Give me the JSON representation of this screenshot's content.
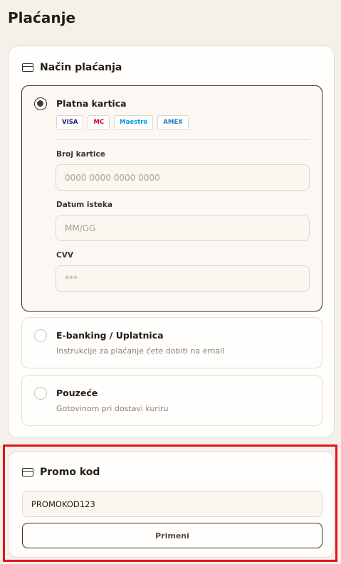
{
  "page": {
    "title": "Plaćanje"
  },
  "payment": {
    "heading": "Način plaćanja",
    "icon": "credit-card-icon",
    "card_option": {
      "title": "Platna kartica",
      "selected": true,
      "badges": [
        {
          "label": "VISA",
          "color": "#1a1f71"
        },
        {
          "label": "MC",
          "color": "#d6002a"
        },
        {
          "label": "Maestro",
          "color": "#0099df"
        },
        {
          "label": "AMEX",
          "color": "#2e77bb"
        }
      ],
      "fields": [
        {
          "label": "Broj kartice",
          "placeholder": "0000 0000 0000 0000",
          "value": ""
        },
        {
          "label": "Datum isteka",
          "placeholder": "MM/GG",
          "value": ""
        },
        {
          "label": "CVV",
          "placeholder": "***",
          "value": ""
        }
      ]
    },
    "ebanking_option": {
      "title": "E-banking / Uplatnica",
      "description": "Instrukcije za plaćanje ćete dobiti na email",
      "selected": false
    },
    "cod_option": {
      "title": "Pouzeće",
      "description": "Gotovinom pri dostavi kuriru",
      "selected": false
    }
  },
  "promo": {
    "heading": "Promo kod",
    "icon": "credit-card-icon",
    "value": "PROMOKOD123",
    "apply_label": "Primeni"
  },
  "colors": {
    "accent": "#3a2e24",
    "background": "#f4f0ea",
    "highlight": "#e0141b"
  }
}
